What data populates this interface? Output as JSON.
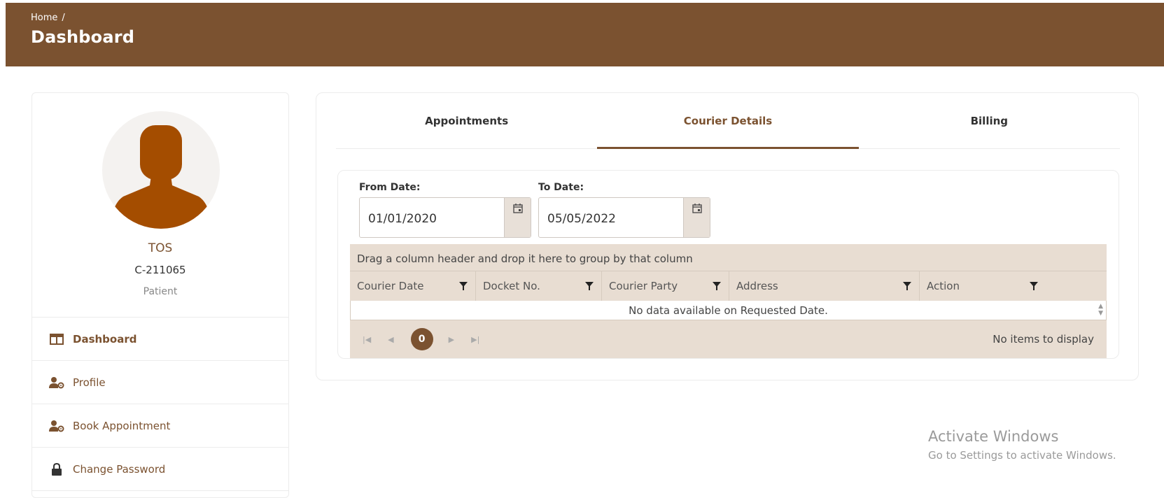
{
  "header": {
    "breadcrumb_home": "Home",
    "breadcrumb_sep": "/",
    "title": "Dashboard"
  },
  "profile": {
    "name": "TOS",
    "id": "C-211065",
    "role": "Patient"
  },
  "sidebar": {
    "items": [
      {
        "label": "Dashboard",
        "icon": "columns-icon"
      },
      {
        "label": "Profile",
        "icon": "user-gear-icon"
      },
      {
        "label": "Book Appointment",
        "icon": "user-gear-icon"
      },
      {
        "label": "Change Password",
        "icon": "lock-icon"
      }
    ]
  },
  "tabs": [
    {
      "label": "Appointments"
    },
    {
      "label": "Courier Details"
    },
    {
      "label": "Billing"
    }
  ],
  "filters": {
    "from_label": "From Date:",
    "from_value": "01/01/2020",
    "to_label": "To Date:",
    "to_value": "05/05/2022"
  },
  "grid": {
    "group_hint": "Drag a column header and drop it here to group by that column",
    "columns": [
      "Courier Date",
      "Docket No.",
      "Courier Party",
      "Address",
      "Action"
    ],
    "empty_message": "No data available on Requested Date.",
    "current_page": "0",
    "pager_status": "No items to display"
  },
  "watermark": {
    "line1": "Activate Windows",
    "line2": "Go to Settings to activate Windows."
  },
  "colors": {
    "brand": "#7b5230",
    "grid_bg": "#e8ddd2"
  }
}
